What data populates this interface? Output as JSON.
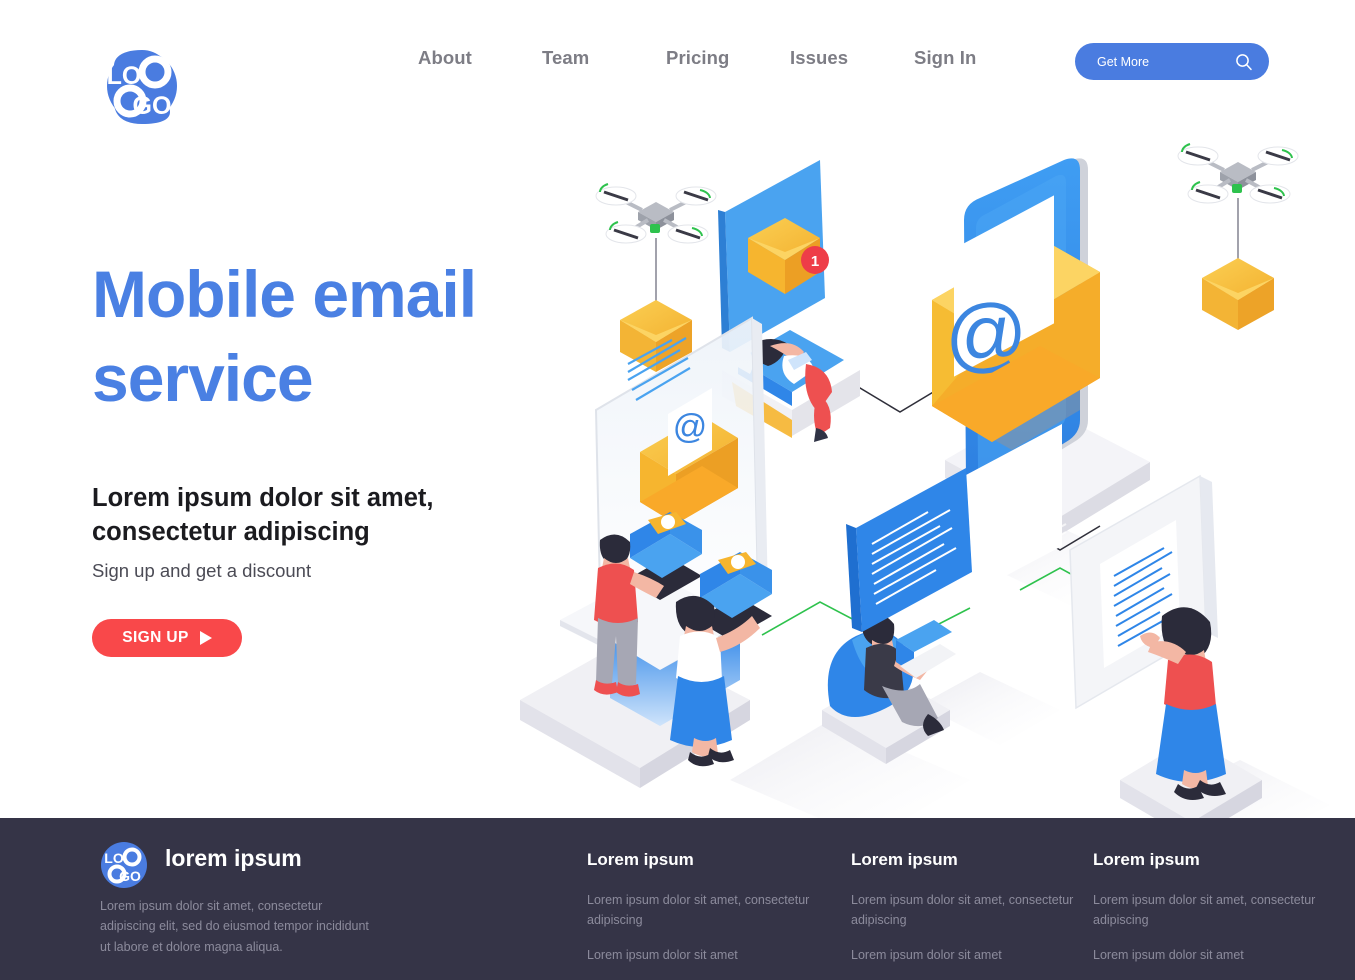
{
  "header": {
    "logo_text_top": "LO",
    "logo_text_bottom": "GO",
    "nav": [
      {
        "label": "About"
      },
      {
        "label": "Team"
      },
      {
        "label": "Pricing"
      },
      {
        "label": "Issues"
      },
      {
        "label": "Sign In"
      }
    ],
    "cta": {
      "label": "Get More",
      "icon": "search-icon",
      "color": "#4a7ce0"
    }
  },
  "hero": {
    "title": "Mobile email service",
    "subtitle": "Lorem ipsum dolor sit amet, consectetur adipiscing",
    "note": "Sign up and get a discount",
    "button": {
      "label": "SIGN UP",
      "icon": "play-icon",
      "color": "#f9484a"
    },
    "title_color": "#4a80e3"
  },
  "illustration": {
    "alt": "Isometric mobile email service scene",
    "notification_badge": "1",
    "at_symbol": "@",
    "colors": {
      "phone_screen": "#3d9bf0",
      "envelope": "#f6ba2b",
      "envelope_dark": "#f4a32a",
      "platform": "#f0f0f4",
      "accent_green": "#2ec24d",
      "accent_red": "#ee3d48",
      "accent_blue": "#2f86e8"
    }
  },
  "footer": {
    "logo_text_top": "LO",
    "logo_text_bottom": "GO",
    "brand": "lorem ipsum",
    "description": "Lorem ipsum dolor sit amet, consectetur adipiscing elit, sed do eiusmod tempor incididunt ut labore et dolore magna aliqua.",
    "background": "#353447",
    "columns": [
      {
        "heading": "Lorem ipsum",
        "groups": [
          "Lorem ipsum dolor sit amet, consectetur adipiscing",
          "Lorem ipsum dolor sit amet"
        ]
      },
      {
        "heading": "Lorem ipsum",
        "groups": [
          "Lorem ipsum dolor sit amet, consectetur adipiscing",
          "Lorem ipsum dolor sit amet"
        ]
      },
      {
        "heading": "Lorem ipsum",
        "groups": [
          "Lorem ipsum dolor sit amet, consectetur adipiscing",
          "Lorem ipsum dolor sit amet"
        ]
      }
    ]
  }
}
